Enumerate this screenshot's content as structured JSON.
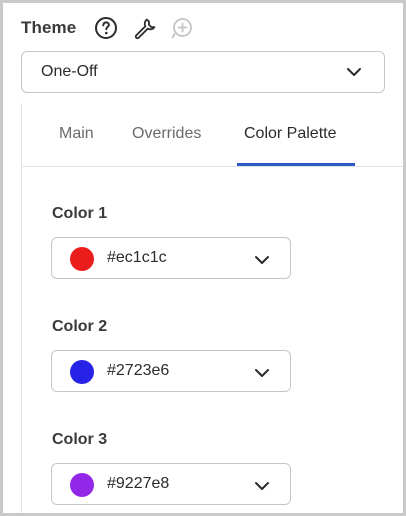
{
  "theme": {
    "label": "Theme",
    "icons": [
      "help-circle-icon",
      "wrench-icon",
      "add-circle-icon"
    ],
    "select_value": "One-Off"
  },
  "tabs": [
    {
      "label": "Main",
      "active": false
    },
    {
      "label": "Overrides",
      "active": false
    },
    {
      "label": "Color Palette",
      "active": true
    }
  ],
  "colors": [
    {
      "label": "Color 1",
      "value": "#ec1c1c"
    },
    {
      "label": "Color 2",
      "value": "#2723e6"
    },
    {
      "label": "Color 3",
      "value": "#9227e8"
    }
  ],
  "accent": "#2f5cc8"
}
